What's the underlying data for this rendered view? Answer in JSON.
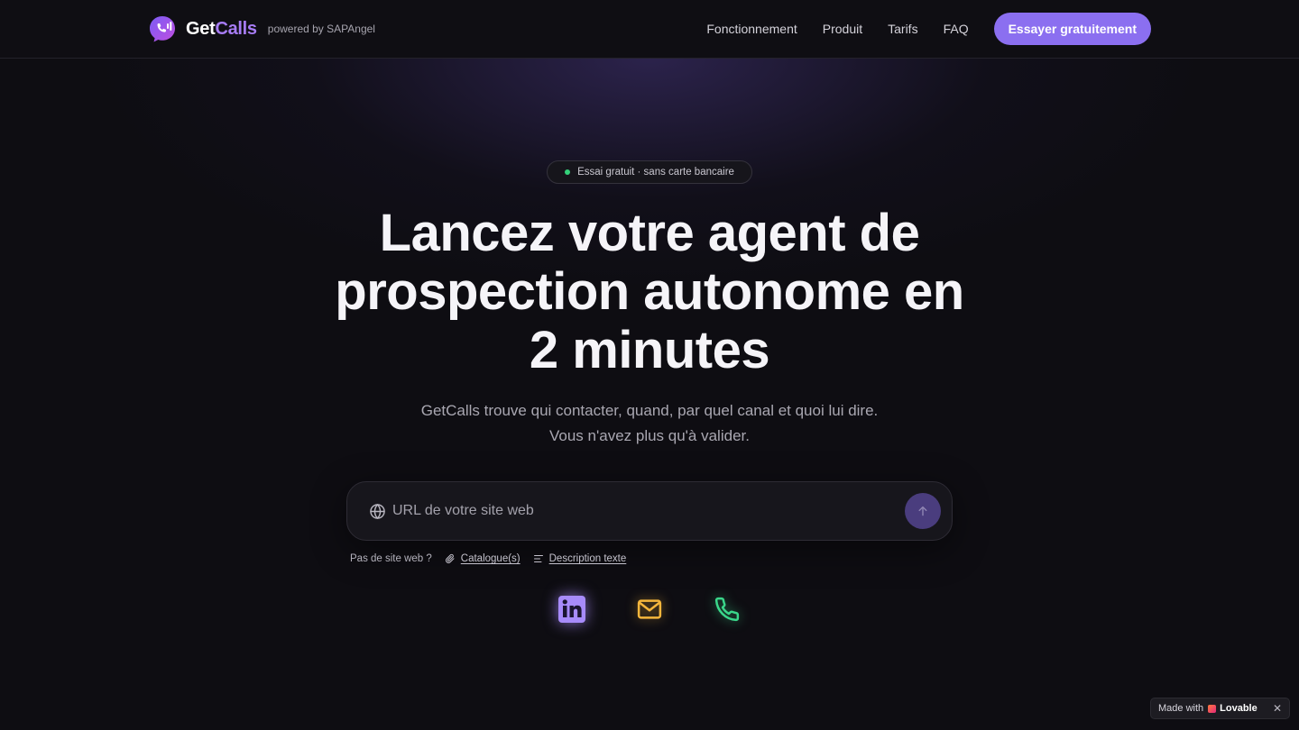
{
  "header": {
    "brand_get": "Get",
    "brand_calls": "Calls",
    "powered_by": "powered by SAPAngel",
    "nav": [
      "Fonctionnement",
      "Produit",
      "Tarifs",
      "FAQ"
    ],
    "cta_label": "Essayer gratuitement"
  },
  "hero": {
    "badge": "Essai gratuit · sans carte bancaire",
    "title_line1": "Lancez votre agent de",
    "title_line2": "prospection autonome en",
    "title_line3": "2 minutes",
    "subtitle_line1": "GetCalls trouve qui contacter, quand, par quel canal et quoi lui dire.",
    "subtitle_line2": "Vous n'avez plus qu'à valider."
  },
  "url_form": {
    "placeholder": "URL de votre site web",
    "value": "",
    "icon": "globe-icon",
    "submit_icon": "arrow-up-icon"
  },
  "alternatives": {
    "prompt": "Pas de site web ?",
    "catalogue": "Catalogue(s)",
    "description": "Description texte"
  },
  "channels": [
    {
      "icon": "linkedin-icon",
      "color": "#a78bfa"
    },
    {
      "icon": "mail-icon",
      "color": "#f5b63c"
    },
    {
      "icon": "phone-icon",
      "color": "#3ad68a"
    }
  ],
  "footer_badge": {
    "made_with": "Made with",
    "brand": "Lovable",
    "close": "✕"
  },
  "colors": {
    "accent": "#8b6ff0",
    "background": "#0e0d12",
    "success_dot": "#34d17a"
  }
}
